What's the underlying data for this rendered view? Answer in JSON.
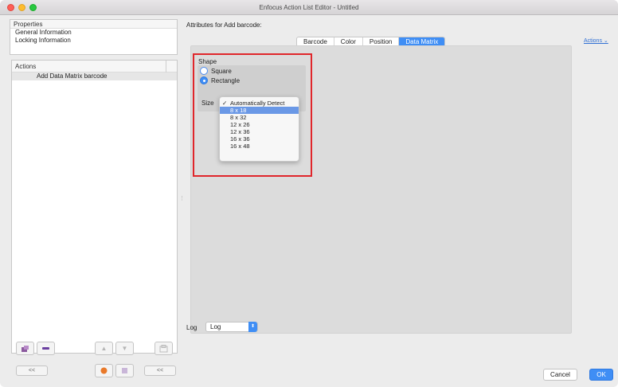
{
  "window": {
    "title": "Enfocus Action List Editor - Untitled"
  },
  "properties": {
    "header": "Properties",
    "items": [
      "General Information",
      "Locking Information"
    ]
  },
  "actions_list": {
    "header": "Actions",
    "items": [
      "Add Data Matrix barcode"
    ]
  },
  "toolbar": {
    "collapse_left": "<<",
    "collapse_right": "<<"
  },
  "attributes": {
    "title": "Attributes for Add barcode:",
    "tabs": [
      "Barcode",
      "Color",
      "Position",
      "Data Matrix"
    ],
    "active_tab": "Data Matrix",
    "actions_menu": "Actions",
    "shape_label": "Shape",
    "shape_options": [
      "Square",
      "Rectangle"
    ],
    "shape_selected": "Rectangle",
    "size_label": "Size",
    "size_options": [
      "Automatically Detect",
      "8 x 18",
      "8 x 32",
      "12 x 26",
      "12 x 36",
      "16 x 36",
      "16 x 48"
    ],
    "size_checked": "Automatically Detect",
    "size_highlighted": "8 x 18"
  },
  "log": {
    "label": "Log",
    "value": "Log"
  },
  "buttons": {
    "cancel": "Cancel",
    "ok": "OK"
  },
  "colors": {
    "accent": "#3f8ef5",
    "highlight": "#6a98e6",
    "annotation_red": "#e0262b"
  }
}
